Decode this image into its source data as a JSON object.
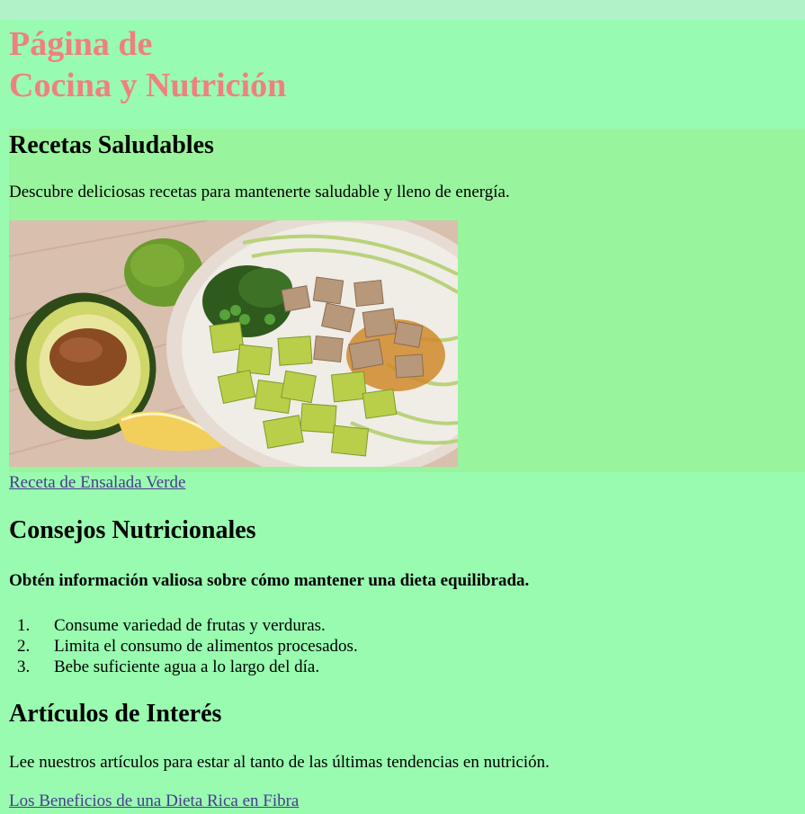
{
  "header": {
    "title": "Página de\nCocina y Nutrición"
  },
  "recipes": {
    "heading": "Recetas Saludables",
    "description": "Descubre deliciosas recetas para mantenerte saludable y lleno de energía.",
    "link_label": "Receta de Ensalada Verde"
  },
  "nutrition": {
    "heading": "Consejos Nutricionales",
    "subtitle": "Obtén información valiosa sobre cómo mantener una dieta equilibrada.",
    "tips": [
      {
        "num": "1.",
        "text": "Consume variedad de frutas y verduras."
      },
      {
        "num": "2.",
        "text": "Limita el consumo de alimentos procesados."
      },
      {
        "num": "3.",
        "text": "Bebe suficiente agua a lo largo del día."
      }
    ]
  },
  "articles": {
    "heading": "Artículos de Interés",
    "description": "Lee nuestros artículos para estar al tanto de las últimas tendencias en nutrición.",
    "link_label": "Los Beneficios de una Dieta Rica en Fibra"
  },
  "colors": {
    "title": "#f08080",
    "page_bg": "#98fbb0",
    "section_bg": "#98f59d",
    "link": "#4b3b8f"
  }
}
